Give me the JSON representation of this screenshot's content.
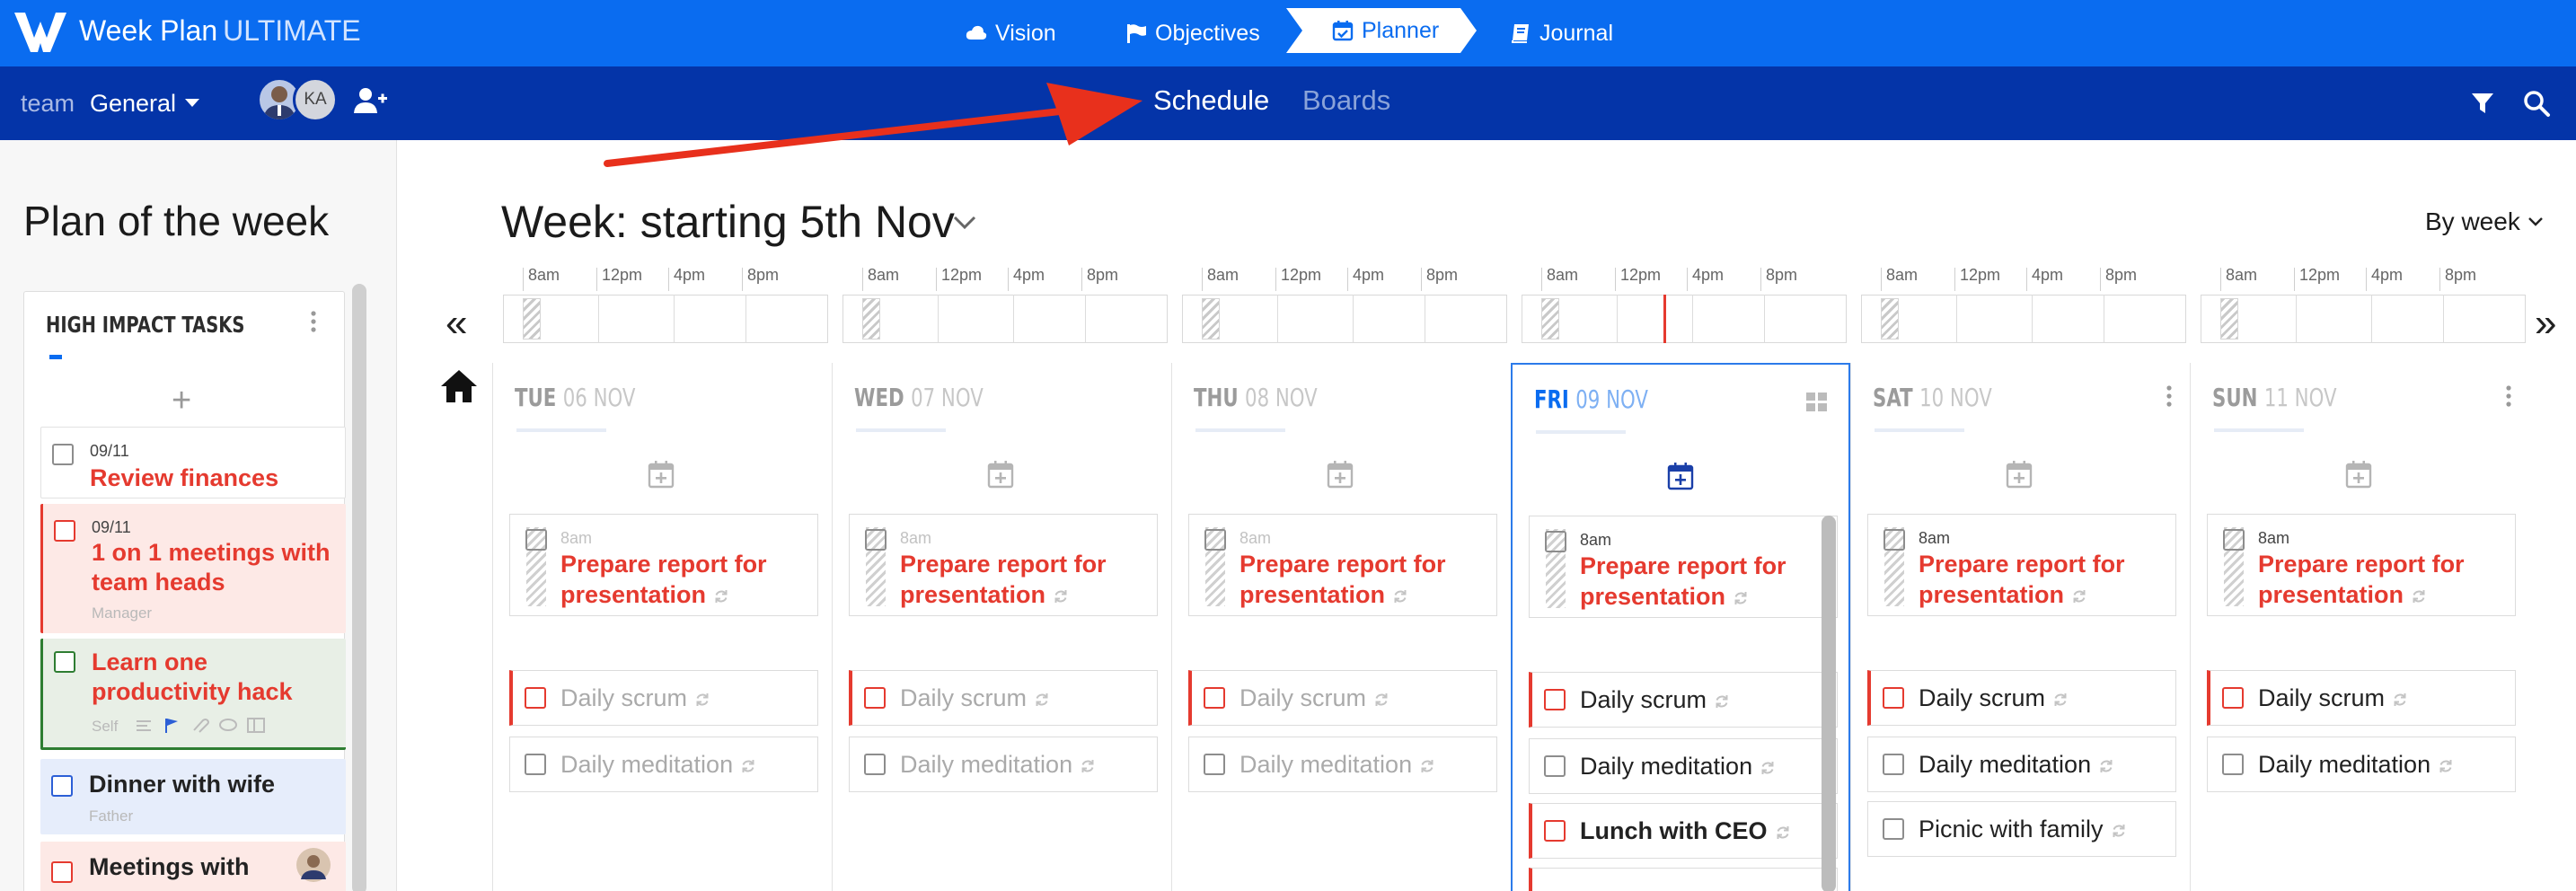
{
  "app": {
    "title_main": "Week Plan",
    "title_edition": "ULTIMATE"
  },
  "nav": {
    "items": [
      {
        "label": "Vision",
        "icon": "cloud-icon"
      },
      {
        "label": "Objectives",
        "icon": "flag-icon"
      },
      {
        "label": "Planner",
        "icon": "calendar-check-icon",
        "active": true
      },
      {
        "label": "Journal",
        "icon": "book-icon"
      }
    ]
  },
  "subbar": {
    "team_prefix": "team",
    "team_name": "General",
    "avatar_initials": "KA",
    "tabs": [
      {
        "label": "Schedule",
        "active": true
      },
      {
        "label": "Boards",
        "active": false
      }
    ]
  },
  "left": {
    "title": "Plan of the week",
    "section_title": "HIGH IMPACT TASKS",
    "add_symbol": "+",
    "tasks": [
      {
        "date": "09/11",
        "title": "Review finances",
        "sub": "",
        "bg": "#ffffff",
        "accent": ""
      },
      {
        "date": "09/11",
        "title": "1 on 1 meetings with team heads",
        "sub": "Manager",
        "bg": "#fde9e6",
        "accent": "#e53a2f"
      },
      {
        "date": "",
        "title": "Learn one productivity hack",
        "sub": "Self",
        "bg": "#e8efe6",
        "accent": "#2e7d32"
      },
      {
        "date": "",
        "title": "Dinner with wife",
        "sub": "Father",
        "bg": "#e6edfb",
        "accent": "#2c5fd6"
      },
      {
        "date": "",
        "title": "Meetings with",
        "sub": "",
        "bg": "#fde9e6",
        "accent": "#e53a2f"
      }
    ]
  },
  "main": {
    "week_label": "Week: starting 5th Nov",
    "view_label": "By week",
    "prev_symbol": "«",
    "next_symbol": "»",
    "timeline_labels": [
      "8am",
      "12pm",
      "4pm",
      "8pm"
    ],
    "days": [
      {
        "name": "TUE",
        "date": "06 NOV",
        "active": false,
        "report_time": "8am",
        "report_title": "Prepare report for presentation",
        "rows": [
          {
            "title": "Daily scrum",
            "red": true,
            "dark": false,
            "bold": false
          },
          {
            "title": "Daily meditation",
            "red": false,
            "dark": false,
            "bold": false
          }
        ]
      },
      {
        "name": "WED",
        "date": "07 NOV",
        "active": false,
        "report_time": "8am",
        "report_title": "Prepare report for presentation",
        "rows": [
          {
            "title": "Daily scrum",
            "red": true,
            "dark": false,
            "bold": false
          },
          {
            "title": "Daily meditation",
            "red": false,
            "dark": false,
            "bold": false
          }
        ]
      },
      {
        "name": "THU",
        "date": "08 NOV",
        "active": false,
        "report_time": "8am",
        "report_title": "Prepare report for presentation",
        "rows": [
          {
            "title": "Daily scrum",
            "red": true,
            "dark": false,
            "bold": false
          },
          {
            "title": "Daily meditation",
            "red": false,
            "dark": false,
            "bold": false
          }
        ]
      },
      {
        "name": "FRI",
        "date": "09 NOV",
        "active": true,
        "report_time": "8am",
        "report_title": "Prepare report for presentation",
        "rows": [
          {
            "title": "Daily scrum",
            "red": true,
            "dark": true,
            "bold": false
          },
          {
            "title": "Daily meditation",
            "red": false,
            "dark": true,
            "bold": false
          },
          {
            "title": "Lunch with CEO",
            "red": true,
            "dark": true,
            "bold": true
          }
        ]
      },
      {
        "name": "SAT",
        "date": "10 NOV",
        "active": false,
        "report_time": "8am",
        "report_title": "Prepare report for presentation",
        "rows": [
          {
            "title": "Daily scrum",
            "red": true,
            "dark": true,
            "bold": false
          },
          {
            "title": "Daily meditation",
            "red": false,
            "dark": true,
            "bold": false
          },
          {
            "title": "Picnic with family",
            "red": false,
            "dark": true,
            "bold": false
          }
        ]
      },
      {
        "name": "SUN",
        "date": "11 NOV",
        "active": false,
        "report_time": "8am",
        "report_title": "Prepare report for presentation",
        "rows": [
          {
            "title": "Daily scrum",
            "red": true,
            "dark": true,
            "bold": false
          },
          {
            "title": "Daily meditation",
            "red": false,
            "dark": true,
            "bold": false
          }
        ]
      }
    ]
  },
  "colors": {
    "brand_blue": "#0a6cf0",
    "dark_blue": "#0434a8",
    "task_red": "#e53a2f",
    "annotation_arrow": "#e8301c"
  }
}
